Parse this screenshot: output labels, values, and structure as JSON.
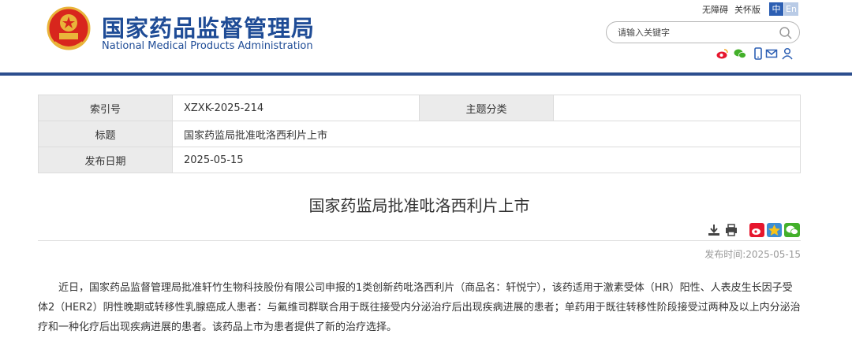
{
  "header": {
    "title_cn": "国家药品监督管理局",
    "title_en": "National Medical Products Administration",
    "accessibility_link": "无障碍",
    "care_link": "关怀版",
    "lang_zh": "中",
    "lang_en": "En",
    "search_placeholder": "请输入关键字",
    "icons": [
      "weibo-icon",
      "wechat-icon",
      "mobile-icon",
      "mail-icon",
      "user-icon"
    ],
    "colors": {
      "brand": "#1f4c96",
      "divider": "#2c4e8e"
    }
  },
  "meta": {
    "index_label": "索引号",
    "index_value": "XZXK-2025-214",
    "topic_label": "主题分类",
    "topic_value": "",
    "title_label": "标题",
    "title_value": "国家药监局批准吡洛西利片上市",
    "date_label": "发布日期",
    "date_value": "2025-05-15"
  },
  "article": {
    "title": "国家药监局批准吡洛西利片上市",
    "publish_label": "发布时间:",
    "publish_value": "2025-05-15",
    "body": "近日，国家药品监督管理局批准轩竹生物科技股份有限公司申报的1类创新药吡洛西利片（商品名：轩悦宁），该药适用于激素受体（HR）阳性、人表皮生长因子受体2（HER2）阴性晚期或转移性乳腺癌成人患者：与氟维司群联合用于既往接受内分泌治疗后出现疾病进展的患者；单药用于既往转移性阶段接受过两种及以上内分泌治疗和一种化疗后出现疾病进展的患者。该药品上市为患者提供了新的治疗选择。"
  }
}
